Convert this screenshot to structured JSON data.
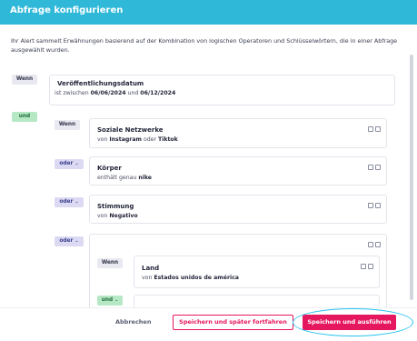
{
  "header": {
    "title": "Abfrage konfigurieren"
  },
  "intro": "Ihr Alert sammelt Erwähnungen basierend auf der Kombination von logischen Operatoren und Schlüsselwörtern, die in einer Abfrage ausgewählt wurden.",
  "date_block": {
    "operator": "Wenn",
    "title": "Veröffentlichungsdatum",
    "prefix": "ist zwischen",
    "from": "06/06/2024",
    "and": "und",
    "to": "06/12/2024"
  },
  "root_operator": "und",
  "conditions": [
    {
      "operator": "Wenn",
      "title": "Soziale Netzwerke",
      "prefix": "von",
      "v1": "Instagram",
      "mid": "oder",
      "v2": "Tiktok"
    },
    {
      "operator": "oder",
      "title": "Körper",
      "prefix": "enthält genau",
      "v1": "nike"
    },
    {
      "operator": "oder",
      "title": "Stimmung",
      "prefix": "von",
      "v1": "Negativo"
    }
  ],
  "nested_group": {
    "operator": "oder",
    "inner_operator": "Wenn",
    "title": "Land",
    "prefix": "von",
    "v1": "Estados unidos de américa",
    "next_operator": "und"
  },
  "footer": {
    "cancel": "Abbrechen",
    "save_later": "Speichern und später fortfahren",
    "save_run": "Speichern und ausführen"
  },
  "colors": {
    "header": "#2fb8d8",
    "primary": "#e5175f",
    "highlight": "#27c3f0"
  }
}
